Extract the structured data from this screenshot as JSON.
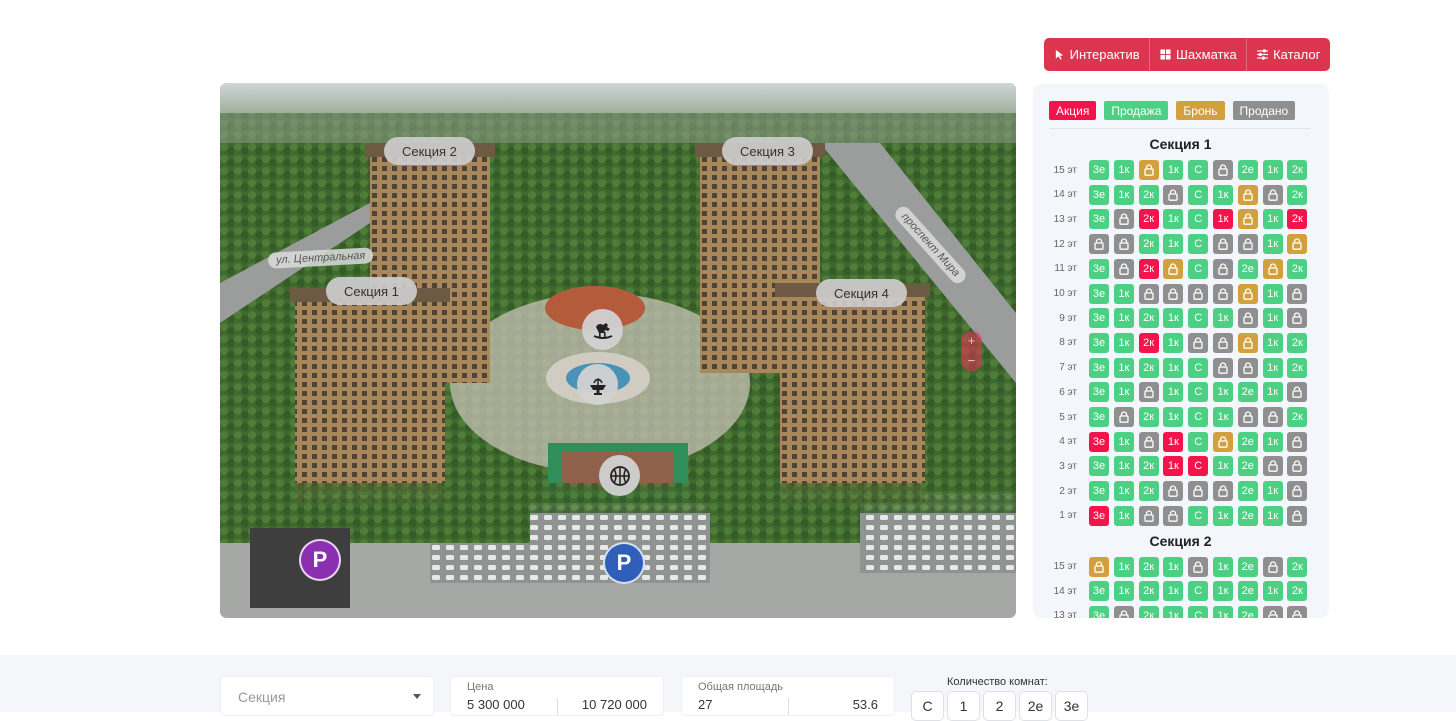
{
  "view_switch": [
    {
      "label": "Интерактив",
      "icon": "pointer-icon"
    },
    {
      "label": "Шахматка",
      "icon": "grid-icon"
    },
    {
      "label": "Каталог",
      "icon": "sliders-icon"
    }
  ],
  "map": {
    "sections": [
      "Секция 2",
      "Секция 3",
      "Секция 1",
      "Секция 4"
    ],
    "streets": [
      "ул. Центральная",
      "проспект Мира"
    ],
    "parking_label": "P",
    "zoom_in": "+",
    "zoom_out": "−"
  },
  "legend": [
    {
      "label": "Акция",
      "color": "#f5134c"
    },
    {
      "label": "Продажа",
      "color": "#4cd083"
    },
    {
      "label": "Бронь",
      "color": "#d3a03e"
    },
    {
      "label": "Продано",
      "color": "#8f8f8f"
    }
  ],
  "status_colors": {
    "A": "#f5134c",
    "S": "#4cd083",
    "B": "#d3a03e",
    "X": "#8f8f8f"
  },
  "chess": [
    {
      "title": "Секция 1",
      "floors": [
        {
          "floor": "15 эт",
          "cells": [
            [
              "3е",
              "S"
            ],
            [
              "1к",
              "S"
            ],
            [
              "",
              "B"
            ],
            [
              "1к",
              "S"
            ],
            [
              "С",
              "S"
            ],
            [
              "",
              "X"
            ],
            [
              "2е",
              "S"
            ],
            [
              "1к",
              "S"
            ],
            [
              "2к",
              "S"
            ]
          ]
        },
        {
          "floor": "14 эт",
          "cells": [
            [
              "3е",
              "S"
            ],
            [
              "1к",
              "S"
            ],
            [
              "2к",
              "S"
            ],
            [
              "",
              "X"
            ],
            [
              "С",
              "S"
            ],
            [
              "1к",
              "S"
            ],
            [
              "",
              "B"
            ],
            [
              "",
              "X"
            ],
            [
              "2к",
              "S"
            ]
          ]
        },
        {
          "floor": "13 эт",
          "cells": [
            [
              "3е",
              "S"
            ],
            [
              "",
              "X"
            ],
            [
              "2к",
              "A"
            ],
            [
              "1к",
              "S"
            ],
            [
              "С",
              "S"
            ],
            [
              "1к",
              "A"
            ],
            [
              "",
              "B"
            ],
            [
              "1к",
              "S"
            ],
            [
              "2к",
              "A"
            ]
          ]
        },
        {
          "floor": "12 эт",
          "cells": [
            [
              "",
              "X"
            ],
            [
              "",
              "X"
            ],
            [
              "2к",
              "S"
            ],
            [
              "1к",
              "S"
            ],
            [
              "С",
              "S"
            ],
            [
              "",
              "X"
            ],
            [
              "",
              "X"
            ],
            [
              "1к",
              "S"
            ],
            [
              "",
              "B"
            ]
          ]
        },
        {
          "floor": "11 эт",
          "cells": [
            [
              "3е",
              "S"
            ],
            [
              "",
              "X"
            ],
            [
              "2к",
              "A"
            ],
            [
              "",
              "B"
            ],
            [
              "С",
              "S"
            ],
            [
              "",
              "X"
            ],
            [
              "2е",
              "S"
            ],
            [
              "",
              "B"
            ],
            [
              "2к",
              "S"
            ]
          ]
        },
        {
          "floor": "10 эт",
          "cells": [
            [
              "3е",
              "S"
            ],
            [
              "1к",
              "S"
            ],
            [
              "",
              "X"
            ],
            [
              "",
              "X"
            ],
            [
              "",
              "X"
            ],
            [
              "",
              "X"
            ],
            [
              "",
              "B"
            ],
            [
              "1к",
              "S"
            ],
            [
              "",
              "X"
            ]
          ]
        },
        {
          "floor": "9 эт",
          "cells": [
            [
              "3е",
              "S"
            ],
            [
              "1к",
              "S"
            ],
            [
              "2к",
              "S"
            ],
            [
              "1к",
              "S"
            ],
            [
              "С",
              "S"
            ],
            [
              "1к",
              "S"
            ],
            [
              "",
              "X"
            ],
            [
              "1к",
              "S"
            ],
            [
              "",
              "X"
            ]
          ]
        },
        {
          "floor": "8 эт",
          "cells": [
            [
              "3е",
              "S"
            ],
            [
              "1к",
              "S"
            ],
            [
              "2к",
              "A"
            ],
            [
              "1к",
              "S"
            ],
            [
              "",
              "X"
            ],
            [
              "",
              "X"
            ],
            [
              "",
              "B"
            ],
            [
              "1к",
              "S"
            ],
            [
              "2к",
              "S"
            ]
          ]
        },
        {
          "floor": "7 эт",
          "cells": [
            [
              "3е",
              "S"
            ],
            [
              "1к",
              "S"
            ],
            [
              "2к",
              "S"
            ],
            [
              "1к",
              "S"
            ],
            [
              "С",
              "S"
            ],
            [
              "",
              "X"
            ],
            [
              "",
              "X"
            ],
            [
              "1к",
              "S"
            ],
            [
              "2к",
              "S"
            ]
          ]
        },
        {
          "floor": "6 эт",
          "cells": [
            [
              "3е",
              "S"
            ],
            [
              "1к",
              "S"
            ],
            [
              "",
              "X"
            ],
            [
              "1к",
              "S"
            ],
            [
              "С",
              "S"
            ],
            [
              "1к",
              "S"
            ],
            [
              "2е",
              "S"
            ],
            [
              "1к",
              "S"
            ],
            [
              "",
              "X"
            ]
          ]
        },
        {
          "floor": "5 эт",
          "cells": [
            [
              "3е",
              "S"
            ],
            [
              "",
              "X"
            ],
            [
              "2к",
              "S"
            ],
            [
              "1к",
              "S"
            ],
            [
              "С",
              "S"
            ],
            [
              "1к",
              "S"
            ],
            [
              "",
              "X"
            ],
            [
              "",
              "X"
            ],
            [
              "2к",
              "S"
            ]
          ]
        },
        {
          "floor": "4 эт",
          "cells": [
            [
              "3е",
              "A"
            ],
            [
              "1к",
              "S"
            ],
            [
              "",
              "X"
            ],
            [
              "1к",
              "A"
            ],
            [
              "С",
              "S"
            ],
            [
              "",
              "B"
            ],
            [
              "2е",
              "S"
            ],
            [
              "1к",
              "S"
            ],
            [
              "",
              "X"
            ]
          ]
        },
        {
          "floor": "3 эт",
          "cells": [
            [
              "3е",
              "S"
            ],
            [
              "1к",
              "S"
            ],
            [
              "2к",
              "S"
            ],
            [
              "1к",
              "A"
            ],
            [
              "С",
              "A"
            ],
            [
              "1к",
              "S"
            ],
            [
              "2е",
              "S"
            ],
            [
              "",
              "X"
            ],
            [
              "",
              "X"
            ]
          ]
        },
        {
          "floor": "2 эт",
          "cells": [
            [
              "3е",
              "S"
            ],
            [
              "1к",
              "S"
            ],
            [
              "2к",
              "S"
            ],
            [
              "",
              "X"
            ],
            [
              "",
              "X"
            ],
            [
              "",
              "X"
            ],
            [
              "2е",
              "S"
            ],
            [
              "1к",
              "S"
            ],
            [
              "",
              "X"
            ]
          ]
        },
        {
          "floor": "1 эт",
          "cells": [
            [
              "3е",
              "A"
            ],
            [
              "1к",
              "S"
            ],
            [
              "",
              "X"
            ],
            [
              "",
              "X"
            ],
            [
              "С",
              "S"
            ],
            [
              "1к",
              "S"
            ],
            [
              "2е",
              "S"
            ],
            [
              "1к",
              "S"
            ],
            [
              "",
              "X"
            ]
          ]
        }
      ]
    },
    {
      "title": "Секция 2",
      "floors": [
        {
          "floor": "15 эт",
          "cells": [
            [
              "",
              "B"
            ],
            [
              "1к",
              "S"
            ],
            [
              "2к",
              "S"
            ],
            [
              "1к",
              "S"
            ],
            [
              "",
              "X"
            ],
            [
              "1к",
              "S"
            ],
            [
              "2е",
              "S"
            ],
            [
              "",
              "X"
            ],
            [
              "2к",
              "S"
            ]
          ]
        },
        {
          "floor": "14 эт",
          "cells": [
            [
              "3е",
              "S"
            ],
            [
              "1к",
              "S"
            ],
            [
              "2к",
              "S"
            ],
            [
              "1к",
              "S"
            ],
            [
              "С",
              "S"
            ],
            [
              "1к",
              "S"
            ],
            [
              "2е",
              "S"
            ],
            [
              "1к",
              "S"
            ],
            [
              "2к",
              "S"
            ]
          ]
        },
        {
          "floor": "13 эт",
          "cells": [
            [
              "3е",
              "S"
            ],
            [
              "",
              "X"
            ],
            [
              "2к",
              "S"
            ],
            [
              "1к",
              "S"
            ],
            [
              "С",
              "S"
            ],
            [
              "1к",
              "S"
            ],
            [
              "2е",
              "S"
            ],
            [
              "",
              "X"
            ],
            [
              "",
              "X"
            ]
          ]
        }
      ]
    }
  ],
  "filters": {
    "section_placeholder": "Секция",
    "price": {
      "label": "Цена",
      "min": "5 300 000",
      "max": "10 720 000"
    },
    "area": {
      "label": "Общая площадь",
      "min": "27",
      "max": "53.6"
    },
    "rooms_label": "Количество комнат:",
    "rooms": [
      "С",
      "1",
      "2",
      "2е",
      "3е"
    ]
  }
}
